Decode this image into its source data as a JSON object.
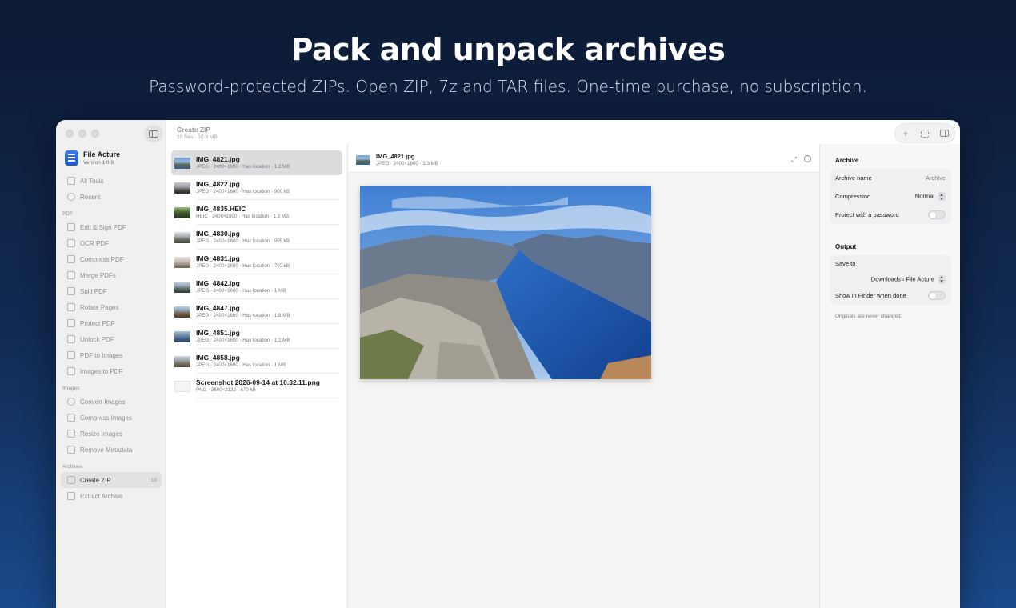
{
  "hero": {
    "title": "Pack and unpack archives",
    "subtitle": "Password-protected ZIPs. Open ZIP, 7z and TAR files. One-time purchase, no subscription."
  },
  "app": {
    "name": "File Acture",
    "version": "Version 1.0.9"
  },
  "toolbar": {
    "title": "Create ZIP",
    "subtitle": "10 files · 10.9 MB",
    "add_icon": "+"
  },
  "sidebar": {
    "top": [
      {
        "label": "All Tools",
        "icon": "grid-icon"
      },
      {
        "label": "Recent",
        "icon": "clock-icon"
      }
    ],
    "sections": [
      {
        "title": "PDF",
        "items": [
          {
            "label": "Edit & Sign PDF",
            "icon": "signature-icon"
          },
          {
            "label": "OCR PDF",
            "icon": "ocr-icon"
          },
          {
            "label": "Compress PDF",
            "icon": "compress-icon"
          },
          {
            "label": "Merge PDFs",
            "icon": "merge-icon"
          },
          {
            "label": "Split PDF",
            "icon": "scissors-icon"
          },
          {
            "label": "Rotate Pages",
            "icon": "rotate-icon"
          },
          {
            "label": "Protect PDF",
            "icon": "lock-icon"
          },
          {
            "label": "Unlock PDF",
            "icon": "unlock-icon"
          },
          {
            "label": "PDF to Images",
            "icon": "pdf-image-icon"
          },
          {
            "label": "Images to PDF",
            "icon": "image-pdf-icon"
          }
        ]
      },
      {
        "title": "Images",
        "items": [
          {
            "label": "Convert Images",
            "icon": "convert-icon"
          },
          {
            "label": "Compress Images",
            "icon": "compress-image-icon"
          },
          {
            "label": "Resize Images",
            "icon": "resize-icon"
          },
          {
            "label": "Remove Metadata",
            "icon": "eraser-icon"
          }
        ]
      },
      {
        "title": "Archives",
        "items": [
          {
            "label": "Create ZIP",
            "icon": "zip-icon",
            "badge": "10",
            "active": true
          },
          {
            "label": "Extract Archive",
            "icon": "extract-icon"
          }
        ]
      }
    ]
  },
  "files": [
    {
      "name": "IMG_4821.jpg",
      "meta": "JPEG · 2400×1600 · Has location · 1.3 MB",
      "thumb": "t1",
      "selected": true
    },
    {
      "name": "IMG_4822.jpg",
      "meta": "JPEG · 2400×1600 · Has location · 900 kB",
      "thumb": "t2"
    },
    {
      "name": "IMG_4835.HEIC",
      "meta": "HEIC · 2400×1600 · Has location · 1.3 MB",
      "thumb": "t3"
    },
    {
      "name": "IMG_4830.jpg",
      "meta": "JPEG · 2400×1600 · Has location · 995 kB",
      "thumb": "t4"
    },
    {
      "name": "IMG_4831.jpg",
      "meta": "JPEG · 2400×1600 · Has location · 702 kB",
      "thumb": "t5"
    },
    {
      "name": "IMG_4842.jpg",
      "meta": "JPEG · 2400×1600 · Has location · 1 MB",
      "thumb": "t6"
    },
    {
      "name": "IMG_4847.jpg",
      "meta": "JPEG · 2400×1600 · Has location · 1.8 MB",
      "thumb": "t7"
    },
    {
      "name": "IMG_4851.jpg",
      "meta": "JPEG · 2400×1600 · Has location · 1.2 MB",
      "thumb": "t8"
    },
    {
      "name": "IMG_4858.jpg",
      "meta": "JPEG · 2400×1600 · Has location · 1 MB",
      "thumb": "t9"
    },
    {
      "name": "Screenshot 2026-09-14 at 10.32.11.png",
      "meta": "PNG · 3600×2132 · 670 kB",
      "thumb": "t10"
    }
  ],
  "preview": {
    "name": "IMG_4821.jpg",
    "meta": "JPEG · 2400×1600 · 1.3 MB"
  },
  "inspector": {
    "archive": {
      "title": "Archive",
      "name_label": "Archive name",
      "name_value": "Archive",
      "compression_label": "Compression",
      "compression_value": "Normal",
      "password_label": "Protect with a password",
      "password_on": false
    },
    "output": {
      "title": "Output",
      "save_label": "Save to",
      "save_value": "Downloads › File Acture",
      "finder_label": "Show in Finder when done",
      "finder_on": false,
      "note": "Originals are never changed."
    }
  }
}
